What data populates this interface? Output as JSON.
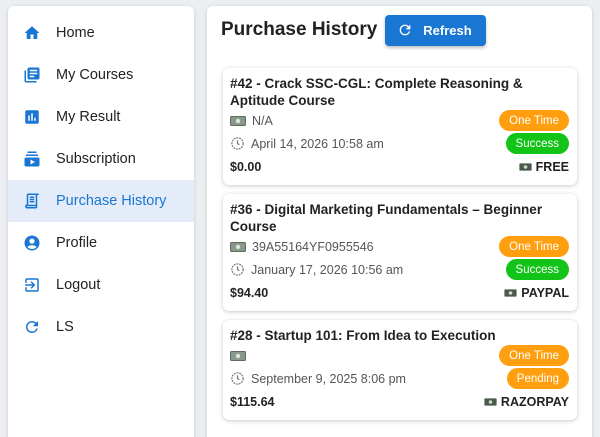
{
  "sidebar": {
    "items": [
      {
        "label": "Home",
        "icon": "home-icon"
      },
      {
        "label": "My Courses",
        "icon": "library-books-icon"
      },
      {
        "label": "My Result",
        "icon": "bar-chart-icon"
      },
      {
        "label": "Subscription",
        "icon": "subscriptions-icon"
      },
      {
        "label": "Purchase History",
        "icon": "receipt-icon",
        "active": true
      },
      {
        "label": "Profile",
        "icon": "account-circle-icon"
      },
      {
        "label": "Logout",
        "icon": "logout-icon"
      },
      {
        "label": "LS",
        "icon": "refresh-icon"
      }
    ]
  },
  "header": {
    "title": "Purchase History",
    "refresh_label": "Refresh"
  },
  "purchases": [
    {
      "title": "#42 - Crack SSC-CGL: Complete Reasoning & Aptitude Course",
      "transaction_id": "N/A",
      "date": "April 14, 2026 10:58 am",
      "amount": "$0.00",
      "type": "One Time",
      "status": "Success",
      "method": "FREE"
    },
    {
      "title": "#36 - Digital Marketing Fundamentals – Beginner Course",
      "transaction_id": "39A55164YF0955546",
      "date": "January 17, 2026 10:56 am",
      "amount": "$94.40",
      "type": "One Time",
      "status": "Success",
      "method": "PAYPAL"
    },
    {
      "title": "#28 - Startup 101: From Idea to Execution",
      "transaction_id": "",
      "date": "September 9, 2025 8:06 pm",
      "amount": "$115.64",
      "type": "One Time",
      "status": "Pending",
      "method": "RAZORPAY"
    }
  ],
  "colors": {
    "accent": "#1976d2",
    "active_bg": "#e3ecf8",
    "badge_orange": "#ff9f0f",
    "badge_green": "#12c417"
  }
}
